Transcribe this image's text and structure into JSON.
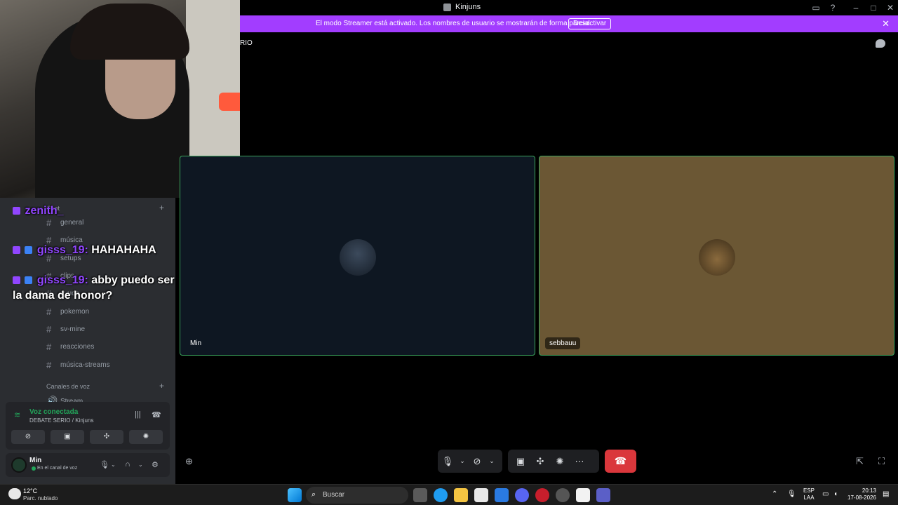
{
  "window": {
    "title": "Kinjuns"
  },
  "banner": {
    "message": "El modo Streamer está activado. Los nombres de usuario se mostrarán de forma parcial.",
    "button": "Desactivar"
  },
  "channel_header": {
    "title_fragment": "RIO"
  },
  "sidebar": {
    "category_label": "Chat",
    "text_channels": [
      "general",
      "música",
      "setups",
      "clips",
      "ayuda",
      "pokemon",
      "sv-mine",
      "reacciones",
      "música-streams"
    ],
    "voice_category": "Canales de voz",
    "voice_channels": [
      "Stream"
    ]
  },
  "chat_overlay": {
    "lines": [
      {
        "user": "zenith_",
        "text": ""
      },
      {
        "user": "gisss_19:",
        "text": "HAHAHAHA"
      },
      {
        "user": "gisss_19:",
        "text": "abby puedo ser la dama de honor?"
      }
    ]
  },
  "voice_panel": {
    "status": "Voz conectada",
    "subtitle": "DEBATE SERIO / Kinjuns"
  },
  "user_panel": {
    "name": "Min",
    "status": "En el canal de voz"
  },
  "tiles": [
    {
      "name": "Min",
      "bg": "#0e1722"
    },
    {
      "name": "sebbauu",
      "bg": "#6b5734"
    }
  ],
  "taskbar": {
    "weather_temp": "12°C",
    "weather_desc": "Parc. nublado",
    "search_placeholder": "Buscar",
    "lang_line1": "ESP",
    "lang_line2": "LAA",
    "time": "20:13",
    "date": "17-08-2026"
  },
  "colors": {
    "banner": "#a23dff",
    "speaking_border": "#3ba55c",
    "hangup": "#da373c",
    "twitch": "#9146ff"
  }
}
